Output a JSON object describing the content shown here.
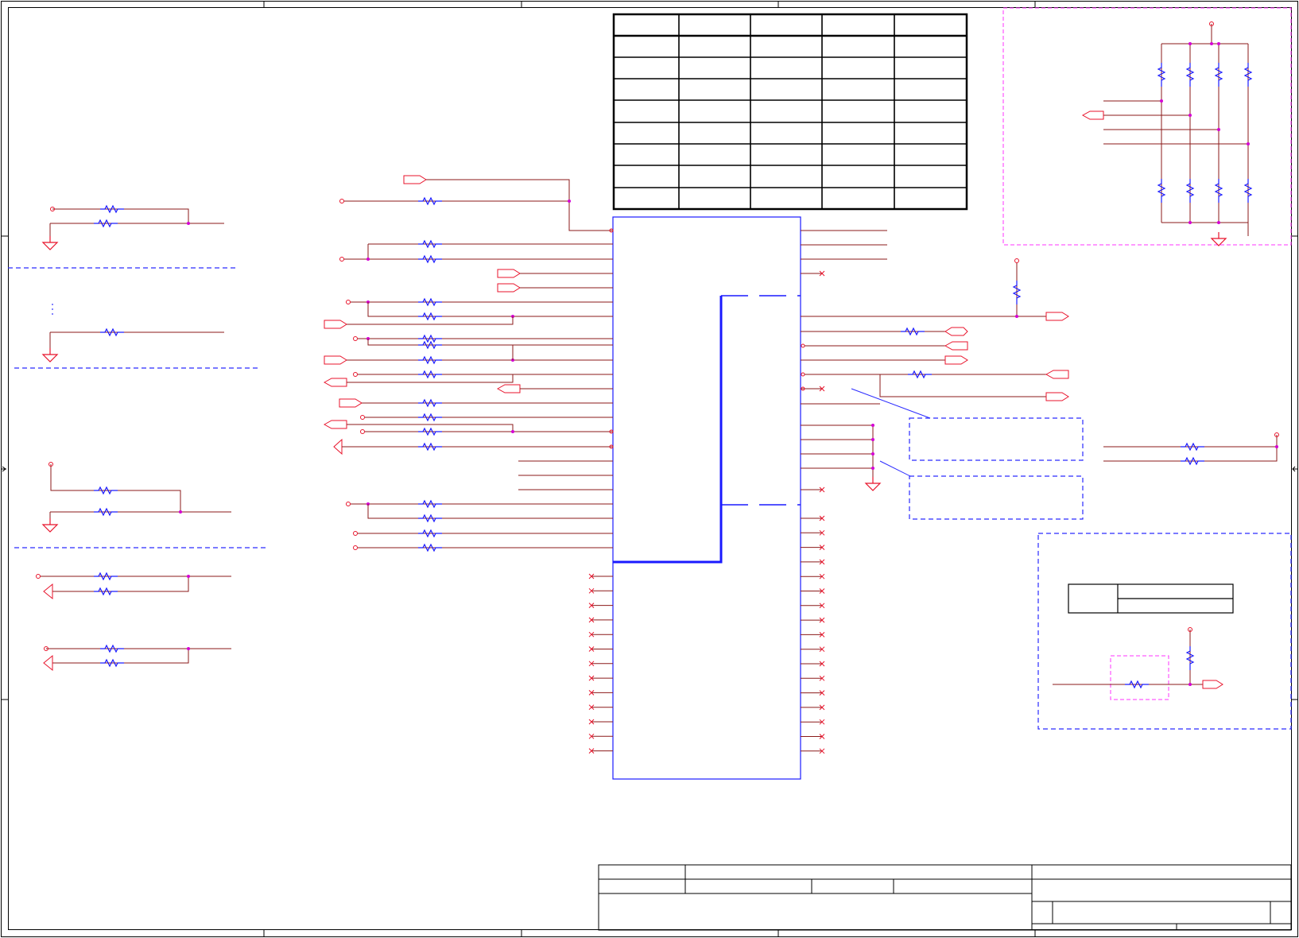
{
  "colors": {
    "frame": "#000000",
    "wire": "#8b1a1a",
    "wire_bright": "#e8132b",
    "component": "#1a1aff",
    "junction": "#d400d4",
    "dashed_region": "#2a2aff",
    "highlight_region": "#ff33ff",
    "background": "#ffffff"
  },
  "sheet": {
    "title_block": {
      "cells": []
    }
  },
  "table": {
    "columns": 5,
    "rows": 9
  },
  "icons": [
    "resistor-icon",
    "ground-icon",
    "power-pin-icon",
    "port-icon",
    "no-connect-icon",
    "junction-dot-icon"
  ]
}
